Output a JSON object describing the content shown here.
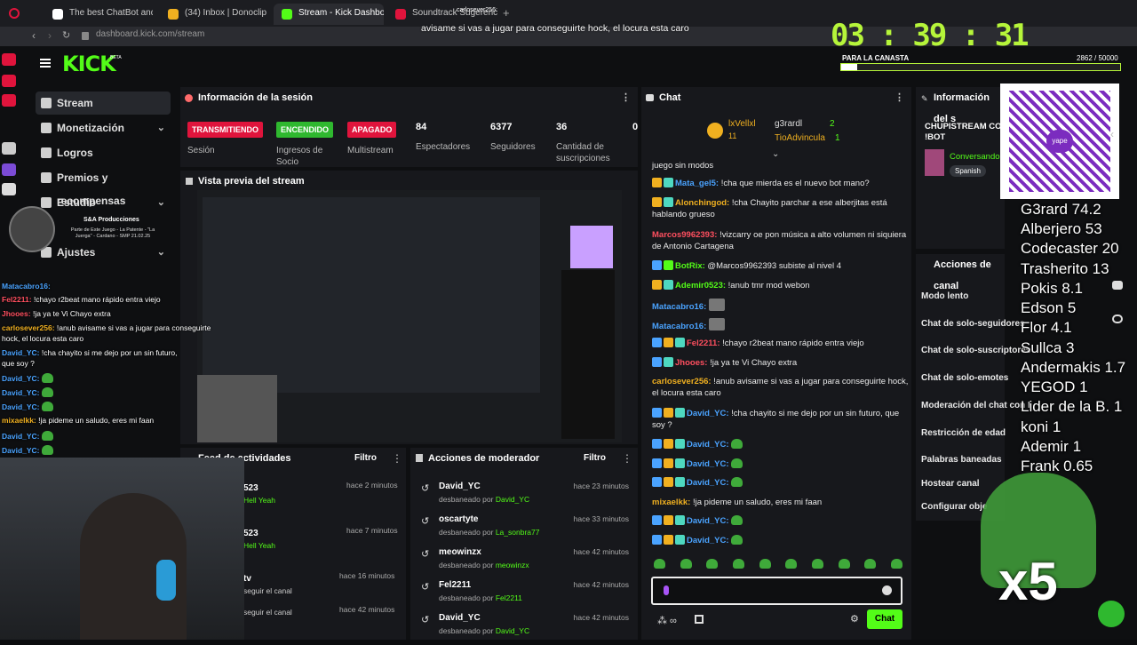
{
  "browser": {
    "tabs": [
      "The best ChatBot and",
      "(34) Inbox | Donoclip",
      "Stream - Kick Dashboard",
      "Soundtrack Sugerencias"
    ],
    "address": "dashboard.kick.com/stream"
  },
  "overlay_top": {
    "user": "carlosever256:",
    "message": "avisame si vas a jugar para conseguirte hock, el locura esta caro"
  },
  "timer": {
    "value": "03 : 39 : 31",
    "goal_label": "PARA LA CANASTA",
    "goal_progress": "2862 / 50000",
    "goal_fraction": 0.057
  },
  "sidebar": {
    "logo": "KICK",
    "logo_sup": "BETA",
    "items": [
      {
        "label": "Stream",
        "icon": "stream-icon"
      },
      {
        "label": "Monetización",
        "icon": "money-icon"
      },
      {
        "label": "Logros",
        "icon": "trophy-icon"
      },
      {
        "label": "Premios y recompensas",
        "icon": "gift-icon"
      },
      {
        "label": "Estudio",
        "icon": "studio-icon"
      },
      {
        "label": "Ajustes",
        "icon": "gear-icon"
      }
    ]
  },
  "profile_overlay": {
    "name": "S&A Producciones",
    "desc": "Parte de Este Juego - La Patente - \"La Juerga\" - Cardano - SMP 21.02.25"
  },
  "session": {
    "title": "Información de la sesión",
    "badges": [
      {
        "label": "TRANSMITIENDO",
        "color": "#e0143c",
        "caption": "Sesión"
      },
      {
        "label": "ENCENDIDO",
        "color": "#2fb82f",
        "caption": "Ingresos de Socio"
      },
      {
        "label": "APAGADO",
        "color": "#e0143c",
        "caption": "Multistream"
      }
    ],
    "stats": [
      {
        "value": "84",
        "label": "Espectadores"
      },
      {
        "value": "6377",
        "label": "Seguidores"
      },
      {
        "value": "36",
        "label": "Cantidad de suscripciones"
      },
      {
        "value": "0",
        "label": ""
      }
    ]
  },
  "preview": {
    "title": "Vista previa del stream"
  },
  "activity": {
    "title": "Feed de actividades",
    "filter": "Filtro",
    "rows": [
      {
        "name": "523",
        "sub": "Hell Yeah",
        "time": "hace 2 minutos"
      },
      {
        "name": "523",
        "sub": "Hell Yeah",
        "time": "hace 7 minutos"
      },
      {
        "name": "tv",
        "sub": "seguir el canal",
        "time": "hace 16 minutos"
      },
      {
        "name": "",
        "sub": "seguir el canal",
        "time": "hace 42 minutos"
      }
    ]
  },
  "moderator": {
    "title": "Acciones de moderador",
    "filter": "Filtro",
    "action_word": "desbaneado por",
    "rows": [
      {
        "name": "David_YC",
        "by": "David_YC",
        "time": "hace 23 minutos"
      },
      {
        "name": "oscartyte",
        "by": "La_sonbra77",
        "time": "hace 33 minutos"
      },
      {
        "name": "meowinzx",
        "by": "meowinzx",
        "time": "hace 42 minutos"
      },
      {
        "name": "Fel2211",
        "by": "Fel2211",
        "time": "hace 42 minutos"
      },
      {
        "name": "David_YC",
        "by": "David_YC",
        "time": "hace 42 minutos"
      }
    ]
  },
  "chat": {
    "title": "Chat",
    "pinned": {
      "top_user": "lxVellxl",
      "top_level": "11",
      "u2": "g3rardl",
      "u2_count": "2",
      "u3": "TioAdvincula",
      "u3_count": "1"
    },
    "messages": [
      {
        "user": "",
        "text": "juego sin modos",
        "color": "#ffffff"
      },
      {
        "user": "Mata_gel5:",
        "text": "!cha que mierda es el nuevo bot mano?",
        "color": "#4aa3ff"
      },
      {
        "user": "Alonchingod:",
        "text": "!cha Chayito parchar a ese alberjitas está hablando grueso",
        "color": "#f0b020"
      },
      {
        "user": "Marcos9962393:",
        "text": "!vizcarry oe pon música a alto volumen ni siquiera de Antonio Cartagena",
        "color": "#ff4f5f"
      },
      {
        "user": "BotRix:",
        "text": "@Marcos9962393 subiste al nivel 4",
        "color": "#53fc18"
      },
      {
        "user": "Ademir0523:",
        "text": "!anub tmr mod webon",
        "color": "#53fc18"
      },
      {
        "user": "Matacabro16:",
        "text": "",
        "color": "#4aa3ff"
      },
      {
        "user": "Matacabro16:",
        "text": "",
        "color": "#4aa3ff"
      },
      {
        "user": "Fel2211:",
        "text": "!chayo r2beat mano rápido entra viejo",
        "color": "#ff4f5f"
      },
      {
        "user": "Jhooes:",
        "text": "!ja ya te Vi Chayo extra",
        "color": "#ff4f5f"
      },
      {
        "user": "carlosever256:",
        "text": "!anub avisame si vas a jugar para conseguirte hock, el locura esta caro",
        "color": "#f0b020"
      },
      {
        "user": "David_YC:",
        "text": "!cha chayito si me dejo por un sin futuro, que soy ?",
        "color": "#4aa3ff"
      },
      {
        "user": "David_YC:",
        "text": "",
        "color": "#4aa3ff"
      },
      {
        "user": "David_YC:",
        "text": "",
        "color": "#4aa3ff"
      },
      {
        "user": "David_YC:",
        "text": "",
        "color": "#4aa3ff"
      },
      {
        "user": "mixaelkk:",
        "text": "!ja pideme un saludo, eres mi faan",
        "color": "#f0b020"
      },
      {
        "user": "David_YC:",
        "text": "",
        "color": "#4aa3ff"
      },
      {
        "user": "David_YC:",
        "text": "",
        "color": "#4aa3ff"
      }
    ],
    "send": "Chat"
  },
  "info_panel": {
    "title": "Información del s",
    "stream_title": "CHUPISTREAM CO !BOT",
    "category": "Conversando",
    "language": "Spanish"
  },
  "channel_actions": {
    "title": "Acciones de canal",
    "items": [
      "Modo lento",
      "Chat de solo-seguidores",
      "Chat de solo-suscriptores",
      "Chat de solo-emotes",
      "Moderación del chat con I",
      "Restricción de edad",
      "Palabras baneadas",
      "Hostear canal",
      "Configurar obje"
    ]
  },
  "leaderboard": [
    "G3rard 74.2",
    "Alberjero 53",
    "Codecaster 20",
    "Trasherito 13",
    "Pokis 8.1",
    "Edson 5",
    "Flor 4.1",
    "Sullca 3",
    "Andermakis 1.7",
    "YEGOD 1",
    "Lider de la B. 1",
    "koni 1",
    "Ademir 1",
    "Frank 0.65"
  ],
  "left_chat_overlay": [
    {
      "user": "Matacabro16:",
      "text": "",
      "color": "#4aa3ff"
    },
    {
      "user": "Fel2211:",
      "text": "!chayo r2beat mano rápido entra viejo",
      "color": "#ff4f5f"
    },
    {
      "user": "Jhooes:",
      "text": "!ja ya te Vi Chayo extra",
      "color": "#ff4f5f"
    },
    {
      "user": "carlosever256:",
      "text": "!anub avisame si vas a jugar para conseguirte",
      "color": "#f0b020"
    },
    {
      "user": "",
      "text": "hock, el locura esta caro",
      "color": "#ffffff"
    },
    {
      "user": "David_YC:",
      "text": "!cha chayito si me dejo por un sin futuro,",
      "color": "#4aa3ff"
    },
    {
      "user": "",
      "text": "que soy ?",
      "color": "#ffffff"
    },
    {
      "user": "David_YC:",
      "text": "",
      "color": "#4aa3ff"
    },
    {
      "user": "David_YC:",
      "text": "",
      "color": "#4aa3ff"
    },
    {
      "user": "David_YC:",
      "text": "",
      "color": "#4aa3ff"
    },
    {
      "user": "mixaelkk:",
      "text": "!ja pideme un saludo, eres mi faan",
      "color": "#f0b020"
    },
    {
      "user": "David_YC:",
      "text": "",
      "color": "#4aa3ff"
    },
    {
      "user": "David_YC:",
      "text": "",
      "color": "#4aa3ff"
    }
  ],
  "emote_overlay": {
    "multiplier": "x5"
  },
  "qr": {
    "label": "yape"
  }
}
